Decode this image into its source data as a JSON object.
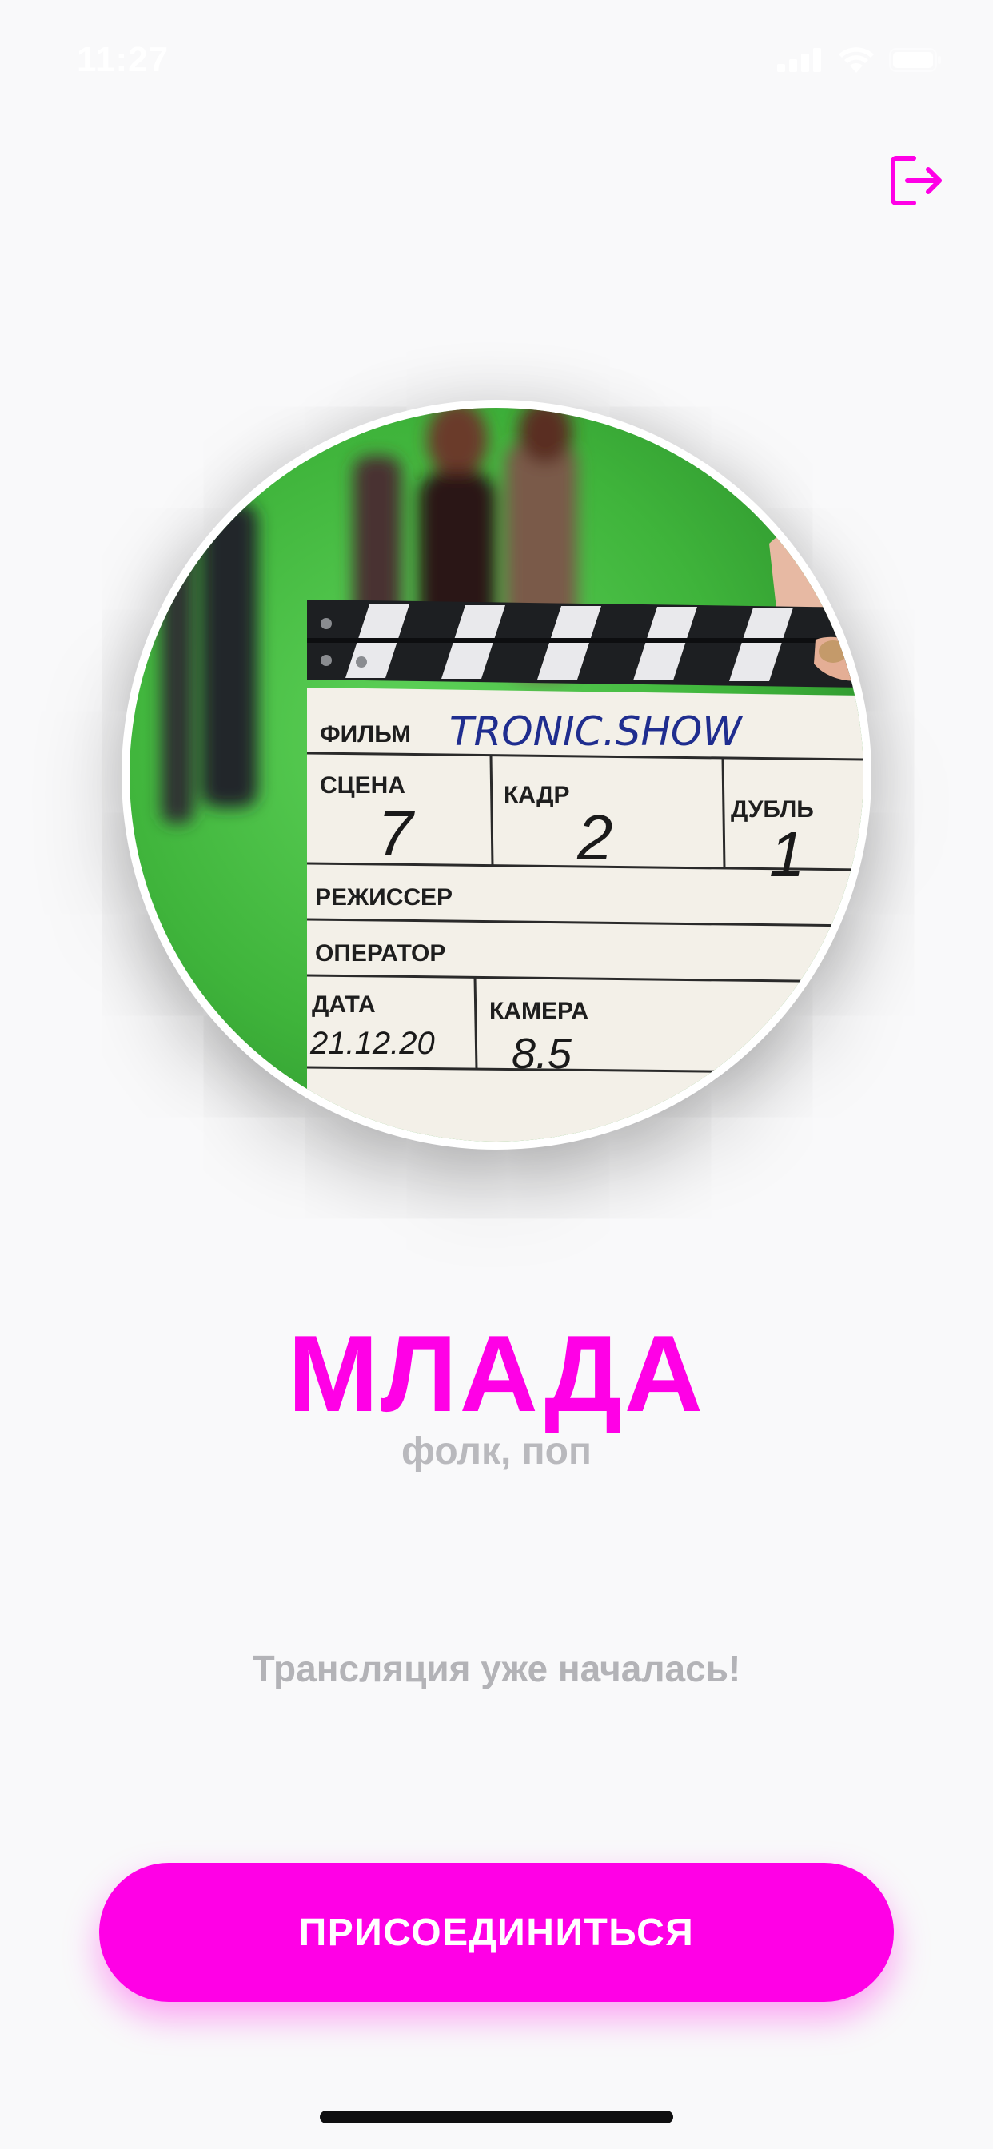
{
  "status_bar": {
    "time": "11:27",
    "icons": [
      "signal-icon",
      "wifi-icon",
      "battery-icon"
    ]
  },
  "header": {
    "logout_icon": "logout-icon"
  },
  "artist": {
    "name": "МЛАДА",
    "genre": "фолк, поп",
    "photo": {
      "slate": {
        "film_label": "ФИЛЬМ",
        "film_value": "TRONIC.SHOW",
        "scene_label": "СЦЕНА",
        "scene_value": "7",
        "shot_label": "КАДР",
        "shot_value": "2",
        "take_label": "ДУБЛЬ",
        "take_value": "1",
        "director_label": "РЕЖИССЕР",
        "operator_label": "ОПЕРАТОР",
        "date_label": "ДАТА",
        "date_value": "21.12.20",
        "camera_label": "КАМЕРА",
        "camera_value": "8.5"
      }
    }
  },
  "broadcast": {
    "status": "Трансляция уже началась!"
  },
  "actions": {
    "join_label": "ПРИСОЕДИНИТЬСЯ"
  },
  "colors": {
    "accent": "#ff00e6",
    "background": "#f9f9fa",
    "muted_text": "#b3b3b7"
  }
}
